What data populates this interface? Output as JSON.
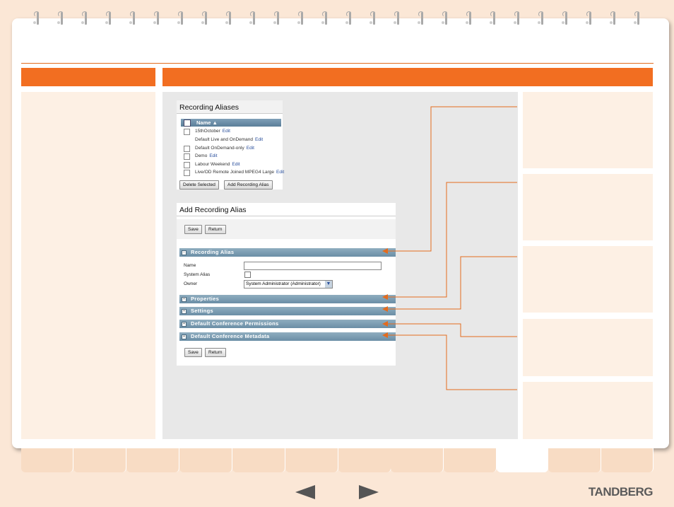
{
  "recording_aliases": {
    "title": "Recording Aliases",
    "column_name": "Name",
    "rows": [
      {
        "name": "15thOctober",
        "edit": "Edit"
      },
      {
        "name": "Default Live and OnDemand",
        "edit": "Edit"
      },
      {
        "name": "Default OnDemand-only",
        "edit": "Edit"
      },
      {
        "name": "Demo",
        "edit": "Edit"
      },
      {
        "name": "Labour Weekend",
        "edit": "Edit"
      },
      {
        "name": "Live/OD Remote Joined MPEG4 Large",
        "edit": "Edit"
      }
    ],
    "delete_button": "Delete Selected",
    "add_button": "Add Recording Alias"
  },
  "add_alias": {
    "title": "Add Recording Alias",
    "save_button": "Save",
    "return_button": "Return",
    "sections": {
      "recording_alias": "Recording Alias",
      "properties": "Properties",
      "settings": "Settings",
      "permissions": "Default Conference Permissions",
      "metadata": "Default Conference Metadata"
    },
    "fields": {
      "name_label": "Name",
      "system_alias_label": "System Alias",
      "owner_label": "Owner",
      "owner_value": "System Administrator (Administrator)"
    }
  },
  "brand": "TANDBERG",
  "colors": {
    "accent": "#f26e21",
    "callout": "#e36b1e"
  }
}
